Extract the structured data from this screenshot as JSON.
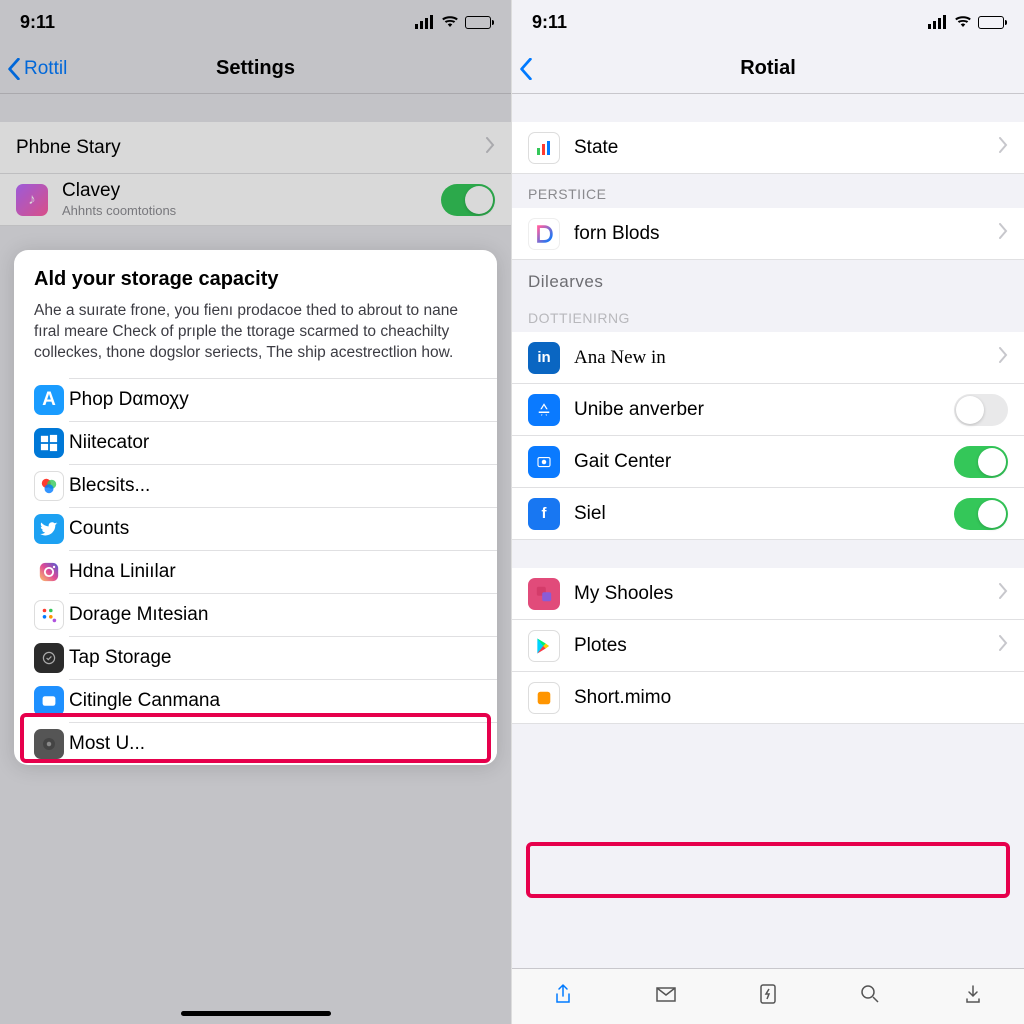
{
  "left": {
    "status_time": "9:11",
    "back_label": "Rottil",
    "nav_title": "Settings",
    "row1_label": "Phbne Stary",
    "row2_label": "Clavey",
    "row2_sub": "Ahhnts coomtotions",
    "card_title": "Ald your storage capacity",
    "card_body": "Ahe a suırate frone, you fienı prodacoe thed to abrout to nane fıral meare Check of prıple the ttorage scarmed to cheachilty colleckes, thone dogslor seriects, The ship acestrectlion how.",
    "card_items": [
      "Phop Dαmοχy",
      "Niitecator",
      "Blecsits...",
      "Counts",
      "Hdna Liniılar",
      "Dorage Mıtesian",
      "Tap Storage",
      "Citingle Canmana",
      "Most U..."
    ]
  },
  "right": {
    "status_time": "9:11",
    "nav_title": "Rotial",
    "row_state": "State",
    "sect_persticse": "PERSTIICE",
    "row_forn": "forn Blods",
    "sect_dilearves": "Dilearves",
    "sect_dot": "DOTTIENIRNG",
    "row_ana": "Ana New in",
    "row_unibe": "Unibe anverber",
    "row_gait": "Gait Center",
    "row_siel": "Siel",
    "row_shooles": "My Shooles",
    "row_plotes": "Plotes",
    "row_short": "Short.mimo"
  }
}
